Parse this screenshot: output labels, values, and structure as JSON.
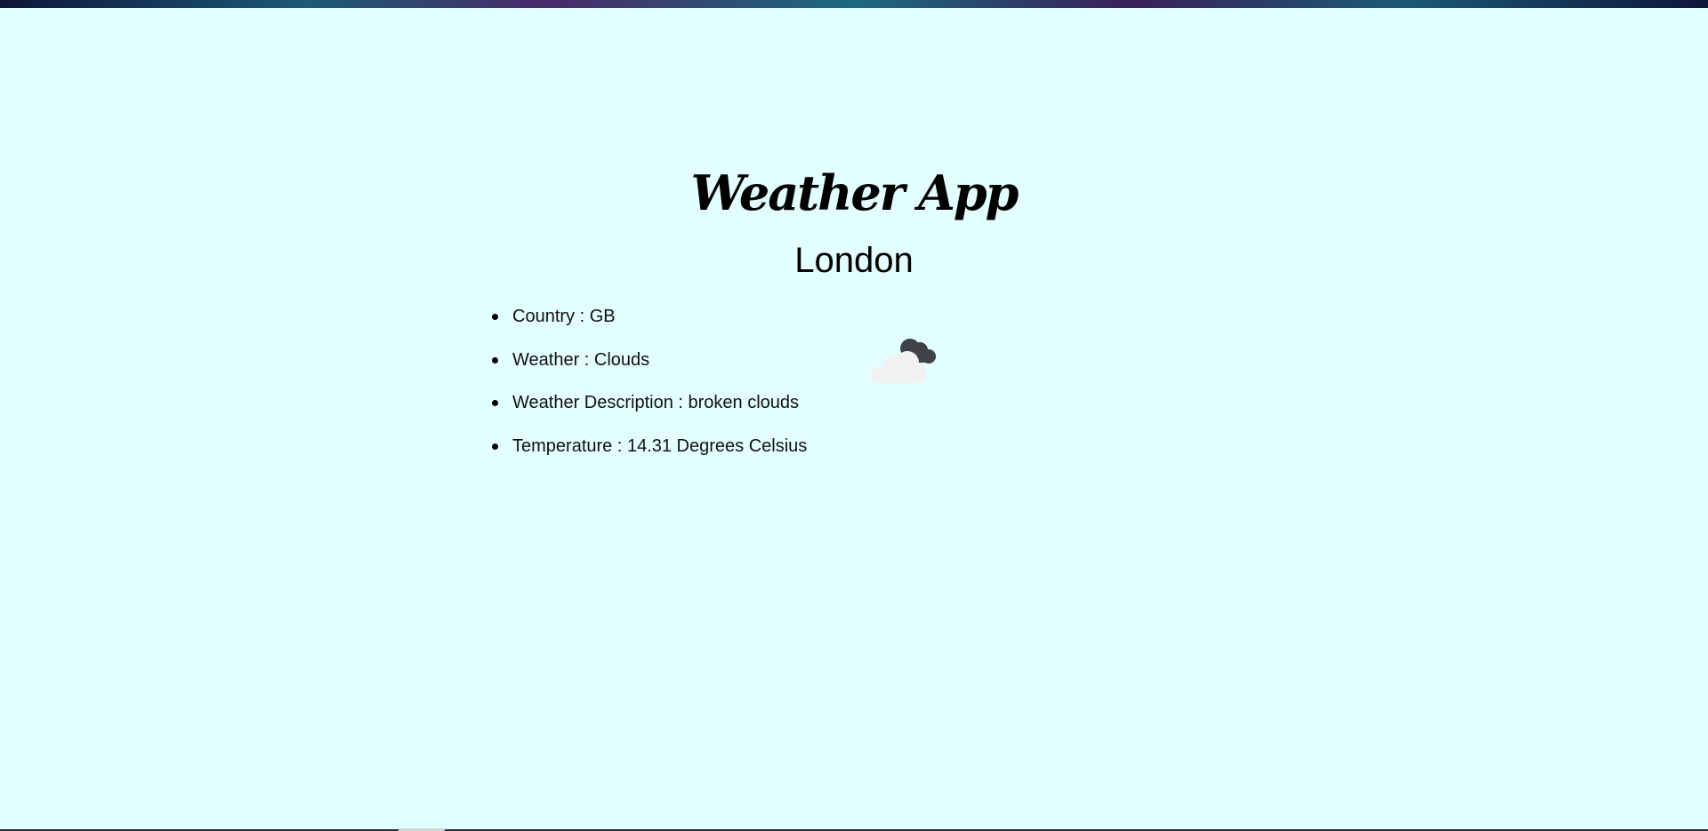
{
  "app": {
    "title": "Weather App",
    "city": "London"
  },
  "details": [
    {
      "label": "Country",
      "separator": " : ",
      "value": "GB",
      "text": "Country : GB"
    },
    {
      "label": "Weather",
      "separator": " : ",
      "value": "Clouds",
      "text": "Weather : Clouds"
    },
    {
      "label": "Weather Description",
      "separator": " : ",
      "value": "broken clouds",
      "text": "Weather Description : broken clouds"
    },
    {
      "label": "Temperature",
      "separator": " : ",
      "value": "14.31 Degrees Celsius",
      "text": "Temperature : 14.31 Degrees Celsius"
    }
  ],
  "icon": {
    "name": "broken-clouds-icon"
  },
  "colors": {
    "background": "#e3feff",
    "text": "#111111",
    "cloud_light": "#f1f1f1",
    "cloud_dark": "#3f4348"
  }
}
